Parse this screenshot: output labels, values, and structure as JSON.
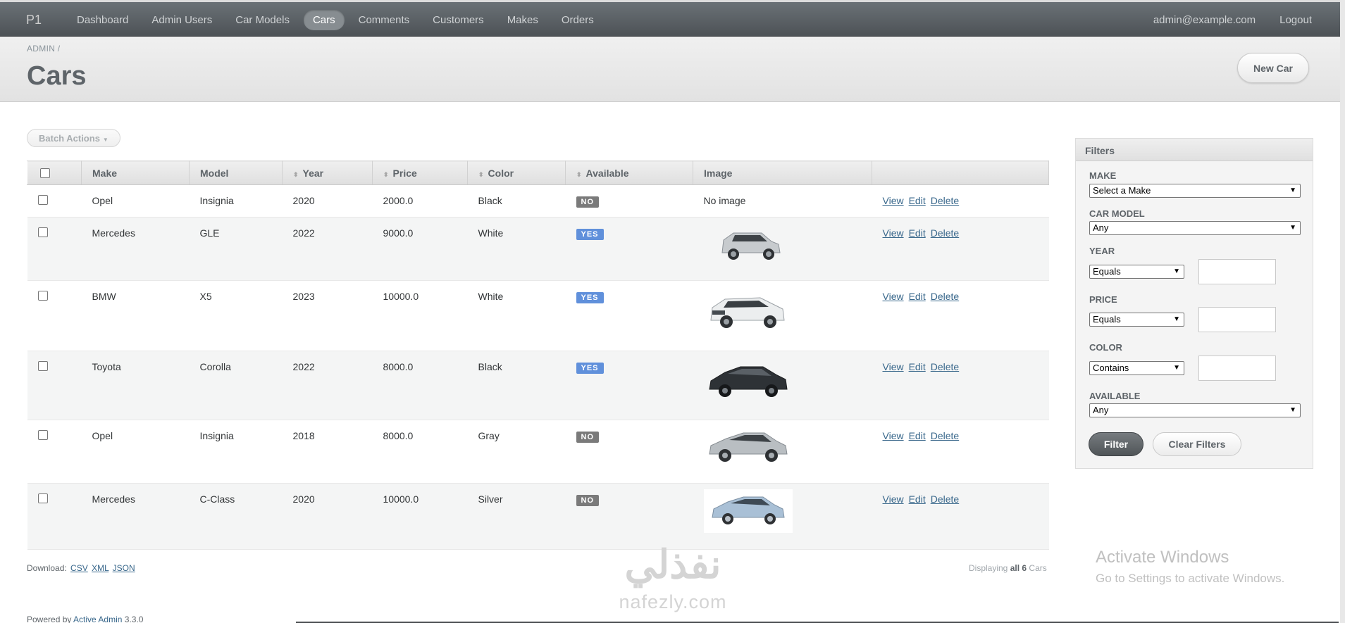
{
  "header": {
    "brand": "P1",
    "nav": [
      "Dashboard",
      "Admin Users",
      "Car Models",
      "Cars",
      "Comments",
      "Customers",
      "Makes",
      "Orders"
    ],
    "active_nav": "Cars",
    "user_email": "admin@example.com",
    "logout": "Logout"
  },
  "title_bar": {
    "breadcrumb": "ADMIN /",
    "title": "Cars",
    "new_button": "New Car"
  },
  "batch_actions": "Batch Actions",
  "table": {
    "columns": [
      "Make",
      "Model",
      "Year",
      "Price",
      "Color",
      "Available",
      "Image"
    ],
    "rows": [
      {
        "make": "Opel",
        "model": "Insignia",
        "year": "2020",
        "price": "2000.0",
        "color": "Black",
        "available": "NO",
        "image": "No image",
        "view": "View",
        "edit": "Edit",
        "delete": "Delete"
      },
      {
        "make": "Mercedes",
        "model": "GLE",
        "year": "2022",
        "price": "9000.0",
        "color": "White",
        "available": "YES",
        "image": "",
        "view": "View",
        "edit": "Edit",
        "delete": "Delete"
      },
      {
        "make": "BMW",
        "model": "X5",
        "year": "2023",
        "price": "10000.0",
        "color": "White",
        "available": "YES",
        "image": "",
        "view": "View",
        "edit": "Edit",
        "delete": "Delete"
      },
      {
        "make": "Toyota",
        "model": "Corolla",
        "year": "2022",
        "price": "8000.0",
        "color": "Black",
        "available": "YES",
        "image": "",
        "view": "View",
        "edit": "Edit",
        "delete": "Delete"
      },
      {
        "make": "Opel",
        "model": "Insignia",
        "year": "2018",
        "price": "8000.0",
        "color": "Gray",
        "available": "NO",
        "image": "",
        "view": "View",
        "edit": "Edit",
        "delete": "Delete"
      },
      {
        "make": "Mercedes",
        "model": "C-Class",
        "year": "2020",
        "price": "10000.0",
        "color": "Silver",
        "available": "NO",
        "image": "",
        "view": "View",
        "edit": "Edit",
        "delete": "Delete"
      }
    ]
  },
  "footer": {
    "download_label": "Download:",
    "csv": "CSV",
    "xml": "XML",
    "json": "JSON",
    "displaying_prefix": "Displaying",
    "displaying_count": "all 6",
    "displaying_suffix": "Cars",
    "powered_by": "Powered by",
    "powered_link": "Active Admin",
    "version": "3.3.0"
  },
  "filters": {
    "title": "Filters",
    "make_label": "MAKE",
    "make_value": "Select a Make",
    "car_model_label": "CAR MODEL",
    "car_model_value": "Any",
    "year_label": "YEAR",
    "year_op": "Equals",
    "price_label": "PRICE",
    "price_op": "Equals",
    "color_label": "COLOR",
    "color_op": "Contains",
    "available_label": "AVAILABLE",
    "available_value": "Any",
    "filter_button": "Filter",
    "clear_button": "Clear Filters"
  },
  "watermark": {
    "arabic": "نفذلي",
    "latin": "nafezly.com"
  },
  "windows_activation": {
    "title": "Activate Windows",
    "subtitle": "Go to Settings to activate Windows."
  },
  "colors": {
    "yes_badge": "#6090db",
    "no_badge": "#7a7a7a",
    "link": "#38678b",
    "header_bg": "#5a5f63"
  }
}
